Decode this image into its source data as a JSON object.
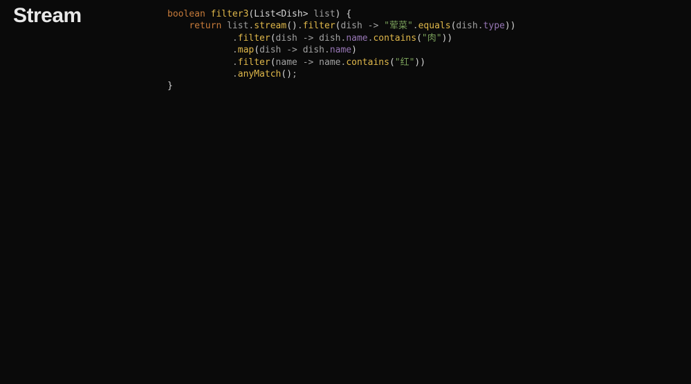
{
  "title": "Stream",
  "code": {
    "line1": {
      "kw_boolean": "boolean",
      "fn_name": "filter3",
      "open_paren": "(",
      "cls_List": "List",
      "lt": "<",
      "cls_Dish": "Dish",
      "gt": ">",
      "space": " ",
      "param": "list",
      "close_paren": ")",
      "open_brace": " {"
    },
    "line2": {
      "indent": "    ",
      "kw_return": "return",
      "sp": " ",
      "ident_list": "list",
      "dot1": ".",
      "m_stream": "stream",
      "call1_op": "(",
      "call1_cp": ")",
      "dot2": ".",
      "m_filter": "filter",
      "fp_op": "(",
      "lam_p": "dish",
      "sp2": " ",
      "arrow": "->",
      "sp3": " ",
      "str1": "\"荤菜\"",
      "dot3": ".",
      "m_equals": "equals",
      "eq_op": "(",
      "lam_p2": "dish",
      "dot4": ".",
      "prop_type": "type",
      "eq_cp": ")",
      "fp_cp": ")"
    },
    "line3": {
      "indent": "            ",
      "dot": ".",
      "m_filter": "filter",
      "op": "(",
      "lam_p": "dish",
      "sp": " ",
      "arrow": "->",
      "sp2": " ",
      "lam_p2": "dish",
      "dot2": ".",
      "prop_name": "name",
      "dot3": ".",
      "m_contains": "contains",
      "c_op": "(",
      "str": "\"肉\"",
      "c_cp": ")",
      "cp": ")"
    },
    "line4": {
      "indent": "            ",
      "dot": ".",
      "m_map": "map",
      "op": "(",
      "lam_p": "dish",
      "sp": " ",
      "arrow": "->",
      "sp2": " ",
      "lam_p2": "dish",
      "dot2": ".",
      "prop_name": "name",
      "cp": ")"
    },
    "line5": {
      "indent": "            ",
      "dot": ".",
      "m_filter": "filter",
      "op": "(",
      "lam_p": "name",
      "sp": " ",
      "arrow": "->",
      "sp2": " ",
      "lam_p2": "name",
      "dot2": ".",
      "m_contains": "contains",
      "c_op": "(",
      "str": "\"红\"",
      "c_cp": ")",
      "cp": ")"
    },
    "line6": {
      "indent": "            ",
      "dot": ".",
      "m_anyMatch": "anyMatch",
      "op": "(",
      "cp": ")",
      "semi": ";"
    },
    "line7": {
      "close_brace": "}"
    }
  }
}
